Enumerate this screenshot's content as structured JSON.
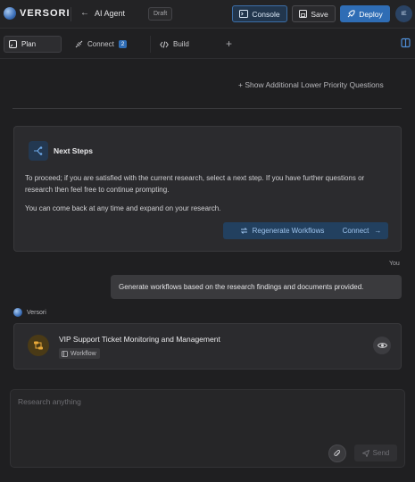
{
  "header": {
    "logo_text": "VERSORI",
    "back_label": "AI Agent",
    "draft_badge": "Draft",
    "console_label": "Console",
    "save_label": "Save",
    "deploy_label": "Deploy",
    "avatar_initials": "IE"
  },
  "tabs": [
    {
      "label": "Plan",
      "icon": "plan-icon"
    },
    {
      "label": "Connect",
      "icon": "connect-icon",
      "badge": "2"
    },
    {
      "label": "Build",
      "icon": "code-icon"
    }
  ],
  "main": {
    "more_questions_label": "+ Show Additional Lower Priority Questions",
    "next_steps": {
      "title": "Next Steps",
      "body_1": "To proceed; if you are satisfied with the current research, select a next step. If you have further questions or research then feel free to continue prompting.",
      "body_2": "You can come back at any time and expand on your research.",
      "regenerate_label": "Regenerate Workflows",
      "connect_label": "Connect"
    },
    "user_message": {
      "author": "You",
      "text": "Generate workflows based on the research findings and documents provided."
    },
    "assistant": {
      "author": "Versori",
      "workflow_title": "VIP Support Ticket Monitoring and Management",
      "workflow_tag": "Workflow"
    }
  },
  "composer": {
    "placeholder": "Research anything",
    "send_label": "Send"
  },
  "colors": {
    "accent": "#2f6db5",
    "background": "#1f1f21",
    "card": "#2b2b2e"
  }
}
